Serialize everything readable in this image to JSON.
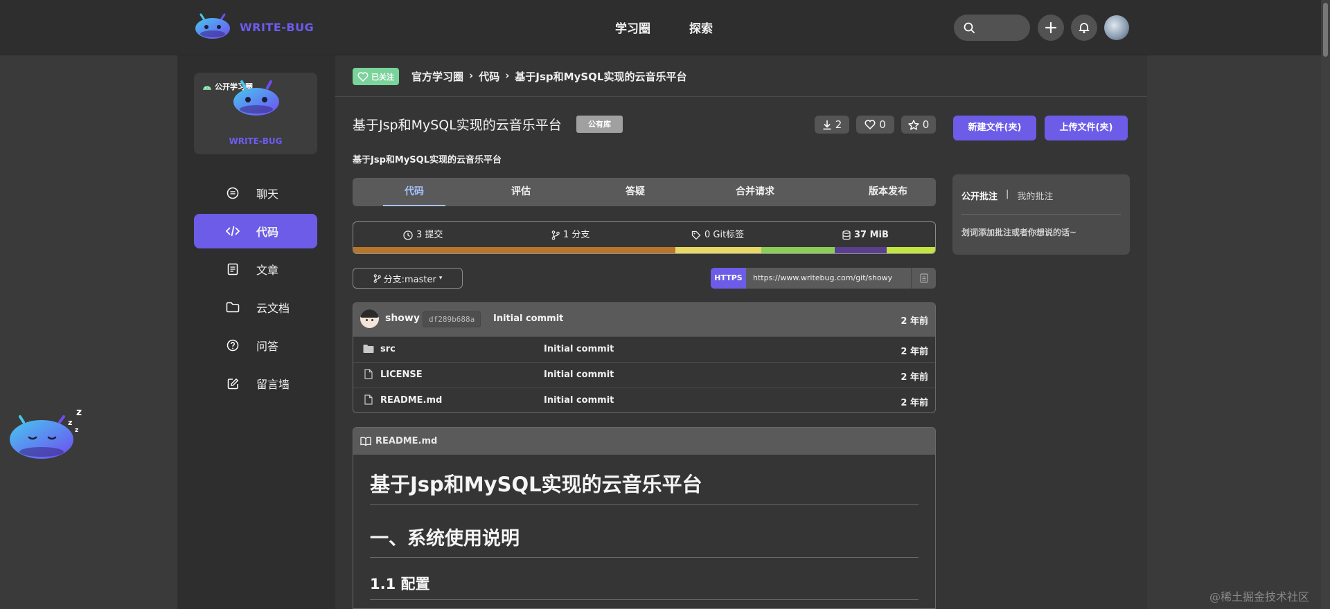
{
  "header": {
    "logo_text": "WRITE-BUG",
    "nav": [
      "学习圈",
      "探索"
    ]
  },
  "sidebar": {
    "card": {
      "tag": "公开学习圈",
      "brand": "WRITE-BUG"
    },
    "items": [
      {
        "label": "聊天",
        "icon": "chat-icon"
      },
      {
        "label": "代码",
        "icon": "code-icon",
        "active": true
      },
      {
        "label": "文章",
        "icon": "article-icon"
      },
      {
        "label": "云文档",
        "icon": "folder-icon"
      },
      {
        "label": "问答",
        "icon": "question-icon"
      },
      {
        "label": "留言墙",
        "icon": "edit-icon"
      }
    ]
  },
  "breadcrumb": {
    "follow_label": "已关注",
    "items": [
      "官方学习圈",
      "代码",
      "基于Jsp和MySQL实现的云音乐平台"
    ]
  },
  "repo": {
    "title": "基于Jsp和MySQL实现的云音乐平台",
    "visibility": "公有库",
    "downloads": "2",
    "likes": "0",
    "stars": "0",
    "description": "基于Jsp和MySQL实现的云音乐平台"
  },
  "tabs": [
    "代码",
    "评估",
    "答疑",
    "合并请求",
    "版本发布"
  ],
  "stats": {
    "commits": "3 提交",
    "branches": "1 分支",
    "tags": "0 Git标签",
    "size": "37 MiB"
  },
  "language_colors": [
    "#b8762a",
    "#e8d864",
    "#8ccd58",
    "#5b3f8f",
    "#c2e63f"
  ],
  "language_shares": [
    0.553,
    0.148,
    0.126,
    0.09,
    0.083
  ],
  "branch": {
    "label": "分支:master"
  },
  "clone": {
    "protocol": "HTTPS",
    "url": "https://www.writebug.com/git/showy"
  },
  "latest_commit": {
    "author": "showy",
    "hash": "df289b688a",
    "message": "Initial commit",
    "time": "2 年前"
  },
  "files": [
    {
      "name": "src",
      "type": "folder",
      "message": "Initial commit",
      "time": "2 年前"
    },
    {
      "name": "LICENSE",
      "type": "file",
      "message": "Initial commit",
      "time": "2 年前"
    },
    {
      "name": "README.md",
      "type": "file",
      "message": "Initial commit",
      "time": "2 年前"
    }
  ],
  "readme": {
    "filename": "README.md",
    "h1": "基于Jsp和MySQL实现的云音乐平台",
    "h2": "一、系统使用说明",
    "h3": "1.1 配置"
  },
  "actions": {
    "new_file": "新建文件(夹)",
    "upload_file": "上传文件(夹)"
  },
  "notes": {
    "tab_public": "公开批注",
    "separator": "|",
    "tab_mine": "我的批注",
    "hint": "划词添加批注或者你想说的话~"
  },
  "watermark": "@稀土掘金技术社区"
}
